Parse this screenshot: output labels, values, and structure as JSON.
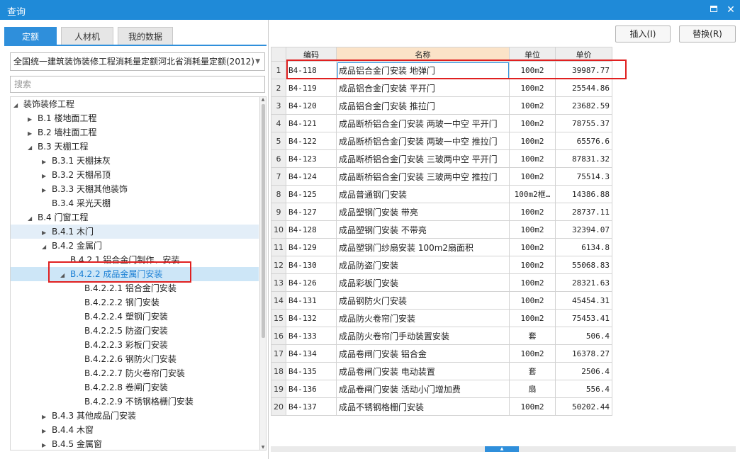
{
  "window": {
    "title": "查询"
  },
  "tabs": [
    {
      "label": "定额",
      "active": true
    },
    {
      "label": "人材机",
      "active": false
    },
    {
      "label": "我的数据",
      "active": false
    }
  ],
  "quota_select": {
    "value": "全国统一建筑装饰装修工程消耗量定额河北省消耗量定额(2012)"
  },
  "search": {
    "placeholder": "搜索"
  },
  "tree": [
    {
      "label": "装饰装修工程",
      "expanded": true
    },
    {
      "label": "B.1 楼地面工程",
      "expanded": false
    },
    {
      "label": "B.2 墙柱面工程",
      "expanded": false
    },
    {
      "label": "B.3 天棚工程",
      "expanded": true
    },
    {
      "label": "B.3.1 天棚抹灰",
      "expanded": false
    },
    {
      "label": "B.3.2 天棚吊顶",
      "expanded": false
    },
    {
      "label": "B.3.3 天棚其他装饰",
      "expanded": false
    },
    {
      "label": "B.3.4 采光天棚",
      "expanded": false
    },
    {
      "label": "B.4 门窗工程",
      "expanded": true
    },
    {
      "label": "B.4.1 木门",
      "expanded": false
    },
    {
      "label": "B.4.2 金属门",
      "expanded": true
    },
    {
      "label": "B.4.2.1 铝合金门制作、安装"
    },
    {
      "label": "B.4.2.2 成品金属门安装",
      "expanded": true,
      "selected": true
    },
    {
      "label": "B.4.2.2.1 铝合金门安装"
    },
    {
      "label": "B.4.2.2.2 钢门安装"
    },
    {
      "label": "B.4.2.2.4 塑钢门安装"
    },
    {
      "label": "B.4.2.2.5 防盗门安装"
    },
    {
      "label": "B.4.2.2.3 彩板门安装"
    },
    {
      "label": "B.4.2.2.6 钢防火门安装"
    },
    {
      "label": "B.4.2.2.7 防火卷帘门安装"
    },
    {
      "label": "B.4.2.2.8 卷闸门安装"
    },
    {
      "label": "B.4.2.2.9 不锈钢格栅门安装"
    },
    {
      "label": "B.4.3 其他成品门安装",
      "expanded": false
    },
    {
      "label": "B.4.4 木窗",
      "expanded": false
    },
    {
      "label": "B.4.5 金属窗",
      "expanded": false
    }
  ],
  "toolbar": {
    "insert_label": "插入(I)",
    "replace_label": "替换(R)"
  },
  "table": {
    "columns": [
      "编码",
      "名称",
      "单位",
      "单价"
    ],
    "rows": [
      {
        "n": "1",
        "code": "B4-118",
        "name": "成品铝合金门安装 地弹门",
        "unit": "100m2",
        "price": "39987.77"
      },
      {
        "n": "2",
        "code": "B4-119",
        "name": "成品铝合金门安装 平开门",
        "unit": "100m2",
        "price": "25544.86"
      },
      {
        "n": "3",
        "code": "B4-120",
        "name": "成品铝合金门安装 推拉门",
        "unit": "100m2",
        "price": "23682.59"
      },
      {
        "n": "4",
        "code": "B4-121",
        "name": "成品断桥铝合金门安装 两玻一中空 平开门",
        "unit": "100m2",
        "price": "78755.37"
      },
      {
        "n": "5",
        "code": "B4-122",
        "name": "成品断桥铝合金门安装 两玻一中空 推拉门",
        "unit": "100m2",
        "price": "65576.6"
      },
      {
        "n": "6",
        "code": "B4-123",
        "name": "成品断桥铝合金门安装 三玻两中空 平开门",
        "unit": "100m2",
        "price": "87831.32"
      },
      {
        "n": "7",
        "code": "B4-124",
        "name": "成品断桥铝合金门安装 三玻两中空 推拉门",
        "unit": "100m2",
        "price": "75514.3"
      },
      {
        "n": "8",
        "code": "B4-125",
        "name": "成品普通钢门安装",
        "unit": "100m2框…",
        "price": "14386.88"
      },
      {
        "n": "9",
        "code": "B4-127",
        "name": "成品塑钢门安装 带亮",
        "unit": "100m2",
        "price": "28737.11"
      },
      {
        "n": "10",
        "code": "B4-128",
        "name": "成品塑钢门安装 不带亮",
        "unit": "100m2",
        "price": "32394.07"
      },
      {
        "n": "11",
        "code": "B4-129",
        "name": "成品塑钢门纱扇安装 100m2扇面积",
        "unit": "100m2",
        "price": "6134.8"
      },
      {
        "n": "12",
        "code": "B4-130",
        "name": "成品防盗门安装",
        "unit": "100m2",
        "price": "55068.83"
      },
      {
        "n": "13",
        "code": "B4-126",
        "name": "成品彩板门安装",
        "unit": "100m2",
        "price": "28321.63"
      },
      {
        "n": "14",
        "code": "B4-131",
        "name": "成品钢防火门安装",
        "unit": "100m2",
        "price": "45454.31"
      },
      {
        "n": "15",
        "code": "B4-132",
        "name": "成品防火卷帘门安装",
        "unit": "100m2",
        "price": "75453.41"
      },
      {
        "n": "16",
        "code": "B4-133",
        "name": "成品防火卷帘门手动装置安装",
        "unit": "套",
        "price": "506.4"
      },
      {
        "n": "17",
        "code": "B4-134",
        "name": "成品卷闸门安装 铝合金",
        "unit": "100m2",
        "price": "16378.27"
      },
      {
        "n": "18",
        "code": "B4-135",
        "name": "成品卷闸门安装 电动装置",
        "unit": "套",
        "price": "2506.4"
      },
      {
        "n": "19",
        "code": "B4-136",
        "name": "成品卷闸门安装 活动小门增加费",
        "unit": "扇",
        "price": "556.4"
      },
      {
        "n": "20",
        "code": "B4-137",
        "name": "成品不锈钢格栅门安装",
        "unit": "100m2",
        "price": "50202.44"
      }
    ]
  },
  "colors": {
    "titlebar": "#1f8ad8",
    "accent": "#2f8fdb",
    "highlight_box": "#e02020",
    "name_header": "#fbe3c8"
  }
}
